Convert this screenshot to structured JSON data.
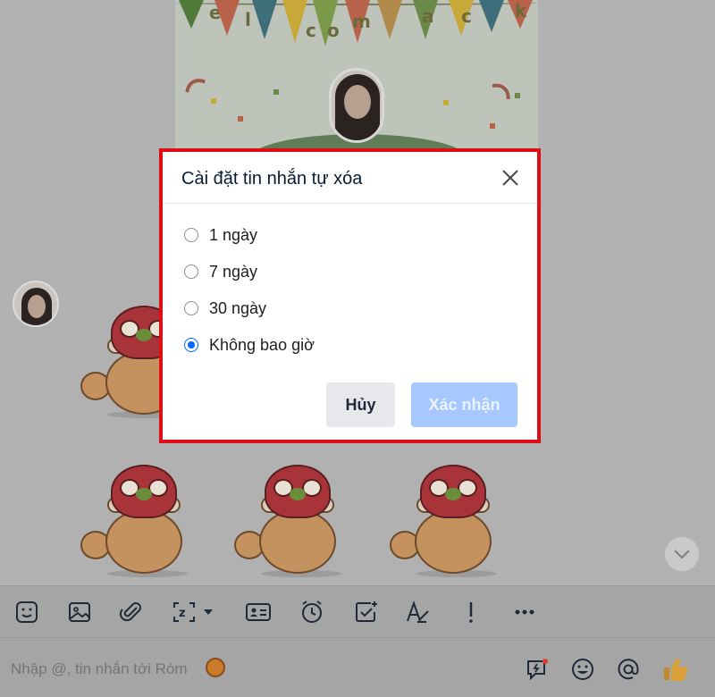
{
  "welcome_card": {
    "letters": [
      "e",
      "l",
      "c",
      "o",
      "m",
      "a",
      "c",
      "k"
    ]
  },
  "dialog": {
    "title": "Cài đặt tin nhắn tự xóa",
    "options": [
      {
        "label": "1 ngày",
        "selected": false
      },
      {
        "label": "7 ngày",
        "selected": false
      },
      {
        "label": "30 ngày",
        "selected": false
      },
      {
        "label": "Không bao giờ",
        "selected": true
      }
    ],
    "cancel_label": "Hủy",
    "confirm_label": "Xác nhận",
    "highlight_color": "#e00d15",
    "accent_color": "#0068ff"
  },
  "toolbar": {
    "icons": [
      "sticker-icon",
      "image-icon",
      "attachment-icon",
      "screenshot-icon",
      "contact-card-icon",
      "reminder-icon",
      "task-icon",
      "text-format-icon",
      "urgent-icon",
      "more-icon"
    ]
  },
  "composer": {
    "placeholder": "Nhập @, tin nhắn tới Róm",
    "icons": [
      "quick-message-icon",
      "emoji-icon",
      "mention-icon",
      "thumbs-up-icon"
    ]
  }
}
